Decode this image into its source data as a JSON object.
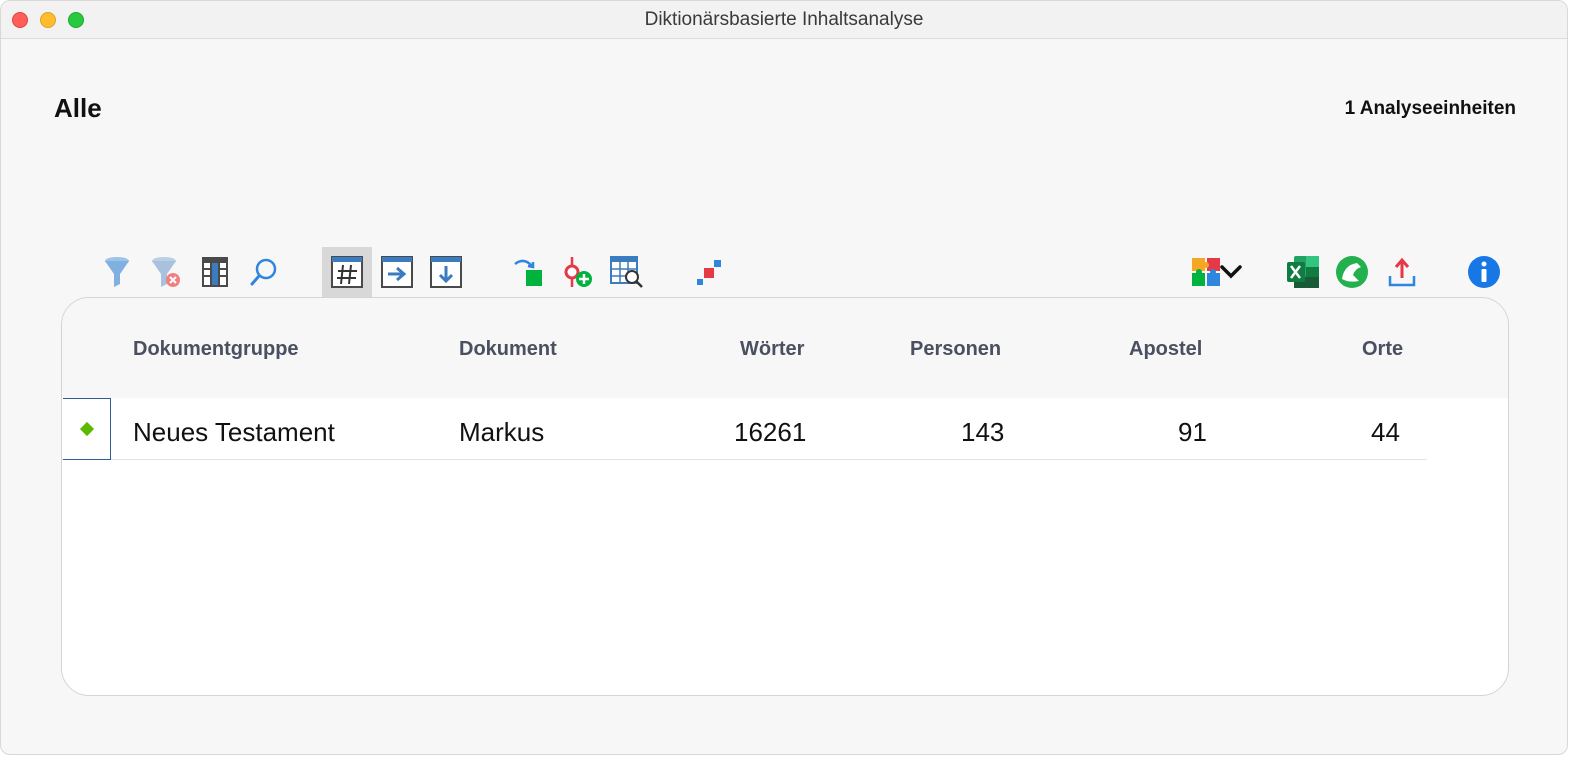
{
  "window": {
    "title": "Diktionärsbasierte Inhaltsanalyse"
  },
  "header": {
    "scope": "Alle",
    "units_count": "1 Analyseeinheiten"
  },
  "toolbar": {
    "icons": [
      "filter-icon",
      "clear-filter-icon",
      "columns-icon",
      "search-icon",
      "frequency-table-icon",
      "move-right-icon",
      "move-down-icon",
      "recode-icon",
      "add-code-icon",
      "table-search-icon",
      "matrix-icon",
      "extensions-icon",
      "chevron-down-icon",
      "excel-icon",
      "spss-icon",
      "export-icon",
      "info-icon"
    ],
    "colors": {
      "accent": "#2e86de",
      "green": "#00b33c",
      "red": "#e63946",
      "info": "#1877e6"
    }
  },
  "table": {
    "columns": [
      "Dokumentgruppe",
      "Dokument",
      "Wörter",
      "Personen",
      "Apostel",
      "Orte"
    ],
    "rows": [
      {
        "group": "Neues Testament",
        "document": "Markus",
        "words": "16261",
        "persons": "143",
        "apostles": "91",
        "places": "44"
      }
    ]
  }
}
